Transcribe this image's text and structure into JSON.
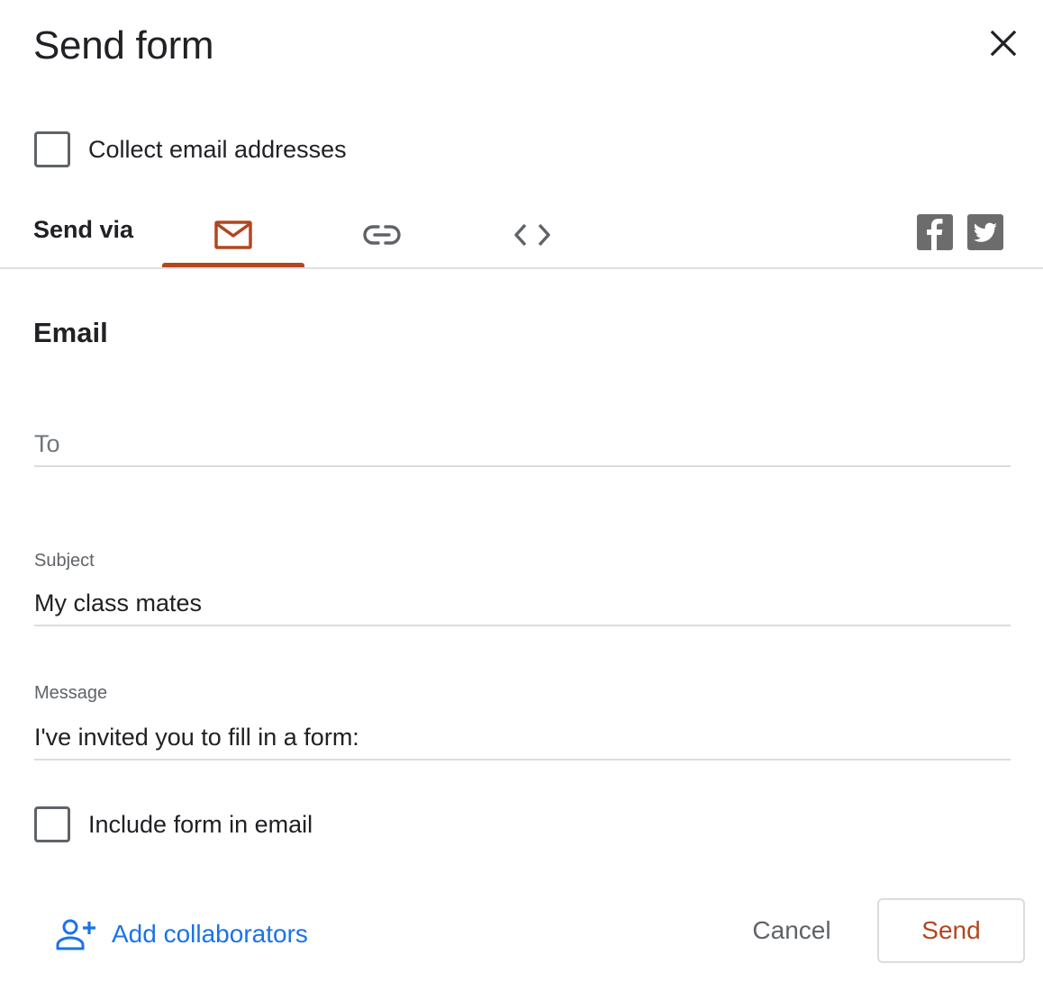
{
  "dialog": {
    "title": "Send form",
    "close_icon": "close-icon"
  },
  "collect_email": {
    "label": "Collect email addresses",
    "checked": false
  },
  "send_via": {
    "label": "Send via",
    "tabs": [
      {
        "name": "email",
        "icon": "mail-icon",
        "selected": true
      },
      {
        "name": "link",
        "icon": "link-icon",
        "selected": false
      },
      {
        "name": "embed",
        "icon": "code-icon",
        "selected": false
      }
    ],
    "social": [
      {
        "name": "facebook",
        "icon": "facebook-icon"
      },
      {
        "name": "twitter",
        "icon": "twitter-icon"
      }
    ]
  },
  "email": {
    "heading": "Email",
    "to": {
      "value": "",
      "placeholder": "To"
    },
    "subject": {
      "label": "Subject",
      "value": "My class mates"
    },
    "message": {
      "label": "Message",
      "value": "I've invited you to fill in a form:"
    },
    "include_form": {
      "label": "Include form in email",
      "checked": false
    }
  },
  "footer": {
    "add_collaborators": "Add collaborators",
    "cancel": "Cancel",
    "send": "Send"
  },
  "colors": {
    "accent": "#b3461f",
    "link_blue": "#1a73e8",
    "social_gray": "#6c6c6c"
  }
}
